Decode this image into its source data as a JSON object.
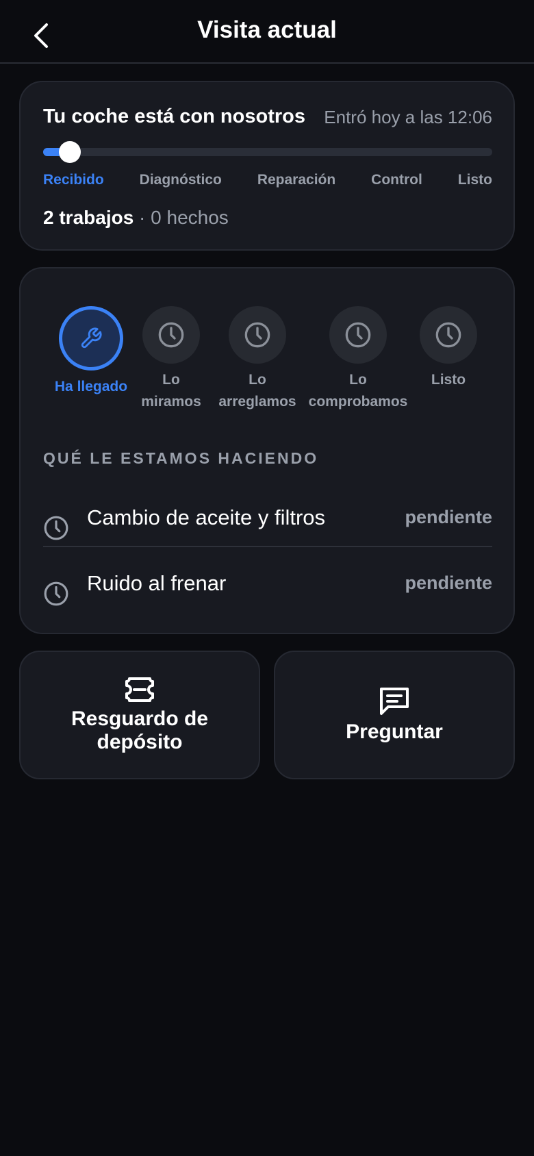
{
  "header": {
    "title": "Visita actual",
    "back_icon": "chevron-left-icon"
  },
  "status_card": {
    "title": "Tu coche está con nosotros",
    "entered": "Entró hoy a las 12:06",
    "progress_fraction": 0.06,
    "stages": [
      "Recibido",
      "Diagnóstico",
      "Reparación",
      "Control",
      "Listo"
    ],
    "active_stage": 0,
    "jobs_count": "2 trabajos",
    "jobs_done": " · 0 hechos"
  },
  "steps": [
    {
      "label": "Ha llegado",
      "icon": "wrench-icon",
      "active": true
    },
    {
      "label": "Lo miramos",
      "icon": "clock-icon",
      "active": false
    },
    {
      "label": "Lo arreglamos",
      "icon": "clock-icon",
      "active": false
    },
    {
      "label": "Lo comprobamos",
      "icon": "clock-icon",
      "active": false
    },
    {
      "label": "Listo",
      "icon": "clock-icon",
      "active": false
    }
  ],
  "jobs_section": {
    "title": "QUÉ LE ESTAMOS HACIENDO",
    "items": [
      {
        "name": "Cambio de aceite y filtros",
        "status": "pendiente",
        "icon": "clock-icon"
      },
      {
        "name": "Ruido al frenar",
        "status": "pendiente",
        "icon": "clock-icon"
      }
    ]
  },
  "actions": {
    "deposit_label": "Resguardo de depósito",
    "deposit_icon": "ticket-icon",
    "ask_label": "Preguntar",
    "ask_icon": "message-icon"
  },
  "colors": {
    "background": "#0b0c10",
    "card": "#181a21",
    "accent": "#3b82f6",
    "muted": "#9aa0ab"
  }
}
